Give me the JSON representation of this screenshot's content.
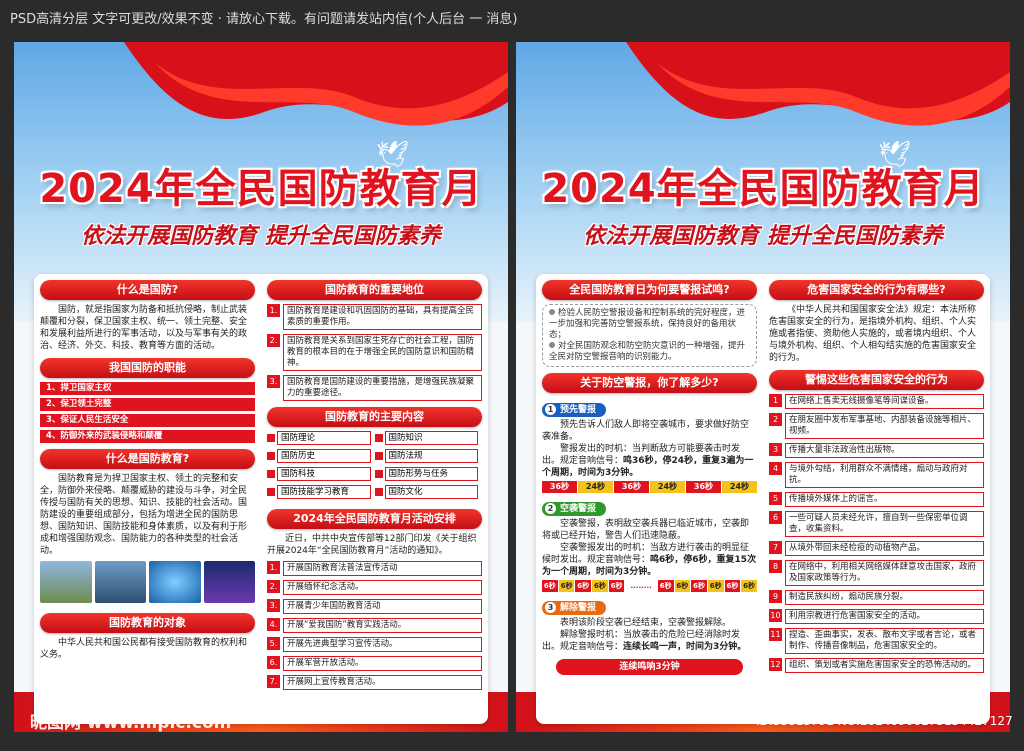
{
  "header_text": "PSD高清分层 文字可更改/效果不变 · 请放心下载。有问题请发站内信(个人后台 一 消息)",
  "poster_title": "2024年全民国防教育月",
  "poster_subtitle": "依法开展国防教育 提升全民国防素养",
  "p1": {
    "left": {
      "h1": "什么是国防?",
      "t1": "国防，就是指国家为防备和抵抗侵略，制止武装颠覆和分裂，保卫国家主权、统一、领土完整、安全和发展利益所进行的军事活动，以及与军事有关的政治、经济、外交、科技、教育等方面的活动。",
      "h2": "我国国防的职能",
      "duties": [
        "1、捍卫国家主权",
        "2、保卫领土完整",
        "3、保证人民生活安全",
        "4、防御外来的武装侵略和颠覆"
      ],
      "h3": "什么是国防教育?",
      "t3": "国防教育是为捍卫国家主权、领土的完整和安全，防御外来侵略、颠覆威胁的建设与斗争，对全民传授与国防有关的思想、知识、技能的社会活动。国防建设的重要组成部分，包括为增进全民的国防思想、国防知识、国防技能和身体素质，以及有利于形成和增强国防观念、国防能力的各种类型的社会活动。",
      "h4": "国防教育的对象",
      "t4": "中华人民共和国公民都有接受国防教育的权利和义务。"
    },
    "right": {
      "h1": "国防教育的重要地位",
      "items": [
        "国防教育是建设和巩固国防的基础，具有提高全民素质的重要作用。",
        "国防教育是关系到国家生死存亡的社会工程，国防教育的根本目的在于增强全民的国防意识和国防精神。",
        "国防教育是国防建设的重要措施，是增强民族凝聚力的重要途径。"
      ],
      "h2": "国防教育的主要内容",
      "content": [
        "国防理论",
        "国防知识",
        "国防历史",
        "国防法规",
        "国防科技",
        "国防形势与任务",
        "国防技能学习教育",
        "国防文化"
      ],
      "h3": "2024年全民国防教育月活动安排",
      "t3": "近日，中共中央宣传部等12部门印发《关于组织开展2024年“全民国防教育月”活动的通知》。",
      "acts": [
        "开展国防教育法普法宣传活动",
        "开展缅怀纪念活动。",
        "开展青少年国防教育活动",
        "开展“爱我国防”教育实践活动。",
        "开展先进典型学习宣传活动。",
        "开展军营开放活动。",
        "开展网上宣传教育活动。"
      ]
    }
  },
  "p2": {
    "left": {
      "h1": "全民国防教育日为何要警报试鸣?",
      "n1": "检验人民防空警报设备和控制系统的完好程度，进一步加强和完善防空警报系统，保持良好的备用状态；",
      "n2": "对全民国防观念和防空防灾意识的一种增强，提升全民对防空警报音响的识别能力。",
      "h2": "关于防空警报，你了解多少?",
      "s1": "预先警报",
      "s1t1": "预先告诉人们敌人即将空袭城市，要求做好防空袭准备。",
      "s1t2": "警报发出的时机：当判断敌方可能要袭击时发出。规定音响信号：",
      "s1t3": "鸣36秒，停24秒，重复3遍为一个周期，时间为3分钟。",
      "seq1": [
        "36秒",
        "24秒",
        "36秒",
        "24秒",
        "36秒",
        "24秒"
      ],
      "s2": "空袭警报",
      "s2t1": "空袭警报，表明敌空袭兵器已临近城市，空袭即将或已经开始，警告人们迅速隐蔽。",
      "s2t2": "空袭警报发出的时机：当敌方进行袭击的明显征候时发出。规定音响信号：",
      "s2t3": "鸣6秒，停6秒，重复15次为一个周期，时间为3分钟。",
      "seq2": [
        "6秒",
        "6秒",
        "6秒",
        "6秒",
        "6秒",
        "........",
        "6秒",
        "6秒",
        "6秒",
        "6秒",
        "6秒",
        "6秒"
      ],
      "s3": "解除警报",
      "s3t1": "表明该阶段空袭已经结束，空袭警报解除。",
      "s3t2": "解除警报时机：当放袭击的危险已经消除时发出。规定音响信号：",
      "s3t3": "连续长鸣一声，时间为3分钟。",
      "final": "连续鸣响3分钟"
    },
    "right": {
      "h1": "危害国家安全的行为有哪些?",
      "t1": "《中华人民共和国国家安全法》规定：本法所称危害国家安全的行为，是指境外机构、组织、个人实施或者指使、资助他人实施的，或者境内组织、个人与境外机构、组织、个人相勾结实施的危害国家安全的行为。",
      "h2": "警惕这些危害国家安全的行为",
      "items": [
        "在网络上售卖无线摄像笔等间谍设备。",
        "在朋友圈中发布军事基地、内部装备设施等相片、视频。",
        "传播大量非法政治性出版物。",
        "与境外勾结，利用群众不满情绪，煽动与政府对抗。",
        "传播境外媒体上的谣言。",
        "一些可疑人员未经允许，擅自到一些保密单位调查，收集资料。",
        "从境外带回未经检疫的动植物产品。",
        "在网络中，利用相关网络媒体肆意攻击国家，政府及国家政策等行为。",
        "制造民族纠纷，煽动民族分裂。",
        "利用宗教进行危害国家安全的活动。",
        "捏造、歪曲事实，发表、散布文字或者言论，或者制作、传播音像制品，危害国家安全的。",
        "组织、策划或者实施危害国家安全的恐怖活动的。"
      ]
    }
  },
  "watermark": "昵图网 www.nipic.com",
  "id_line": "ID:33813791 NO:20240906175154427127"
}
